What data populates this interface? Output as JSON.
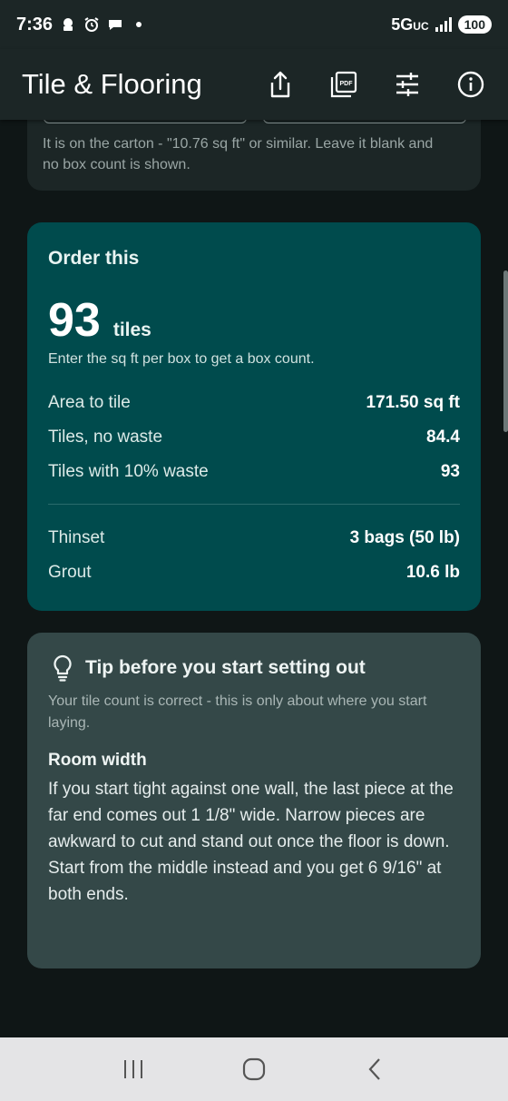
{
  "status": {
    "time": "7:36",
    "network": "5G",
    "network_suffix": "UC",
    "battery": "100"
  },
  "app_bar": {
    "title": "Tile & Flooring",
    "actions": [
      {
        "icon": "share-icon"
      },
      {
        "icon": "pdf-icon",
        "label": "PDF"
      },
      {
        "icon": "tune-icon"
      },
      {
        "icon": "info-icon"
      }
    ]
  },
  "box_card": {
    "hint": "It is on the carton - \"10.76 sq ft\" or similar. Leave it blank and no box count is shown."
  },
  "order": {
    "title": "Order this",
    "count": "93",
    "unit": "tiles",
    "note": "Enter the sq ft per box to get a box count.",
    "rows": [
      {
        "label": "Area to tile",
        "value": "171.50 sq ft"
      },
      {
        "label": "Tiles, no waste",
        "value": "84.4"
      },
      {
        "label": "Tiles with 10% waste",
        "value": "93"
      }
    ],
    "materials": [
      {
        "label": "Thinset",
        "value": "3 bags (50 lb)"
      },
      {
        "label": "Grout",
        "value": "10.6 lb"
      }
    ]
  },
  "tip": {
    "icon": "lightbulb-icon",
    "title": "Tip before you start setting out",
    "subtitle": "Your tile count is correct - this is only about where you start laying.",
    "heading": "Room width",
    "body1": "If you start tight against one wall, the last piece at the far end comes out 1 1/8\" wide. Narrow pieces are awkward to cut and stand out once the floor is down.",
    "body2": "Start from the middle instead and you get 6 9/16\" at both ends."
  },
  "colors": {
    "app_bar": "#1c2626",
    "order_card": "#004b4d",
    "tip_card": "#344848",
    "background": "#0f1616"
  }
}
